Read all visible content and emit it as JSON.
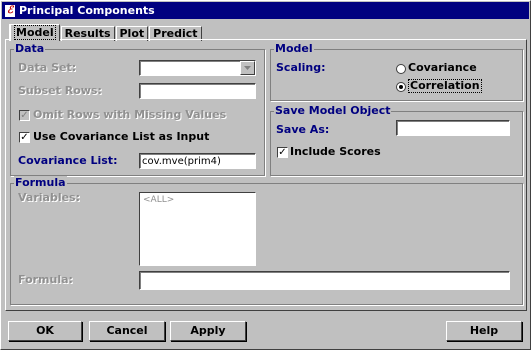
{
  "window": {
    "title": "Principal Components"
  },
  "tabs": [
    {
      "label": "Model"
    },
    {
      "label": "Results"
    },
    {
      "label": "Plot"
    },
    {
      "label": "Predict"
    }
  ],
  "data_group": {
    "legend": "Data",
    "data_set_label": "Data Set:",
    "data_set_value": "",
    "subset_rows_label": "Subset Rows:",
    "subset_rows_value": "",
    "omit_rows_label": "Omit Rows with Missing Values",
    "omit_rows_checked": true,
    "use_cov_label": "Use Covariance List as Input",
    "use_cov_checked": true,
    "cov_list_label": "Covariance List:",
    "cov_list_value": "cov.mve(prim4)"
  },
  "model_group": {
    "legend": "Model",
    "scaling_label": "Scaling:",
    "options": [
      "Covariance",
      "Correlation"
    ],
    "selected": "Correlation"
  },
  "save_group": {
    "legend": "Save Model Object",
    "save_as_label": "Save As:",
    "save_as_value": "",
    "include_scores_label": "Include Scores",
    "include_scores_checked": true
  },
  "formula_group": {
    "legend": "Formula",
    "variables_label": "Variables:",
    "variables_items": [
      "<ALL>"
    ],
    "formula_label": "Formula:",
    "formula_value": ""
  },
  "buttons": {
    "ok": "OK",
    "cancel": "Cancel",
    "apply": "Apply",
    "help": "Help"
  }
}
